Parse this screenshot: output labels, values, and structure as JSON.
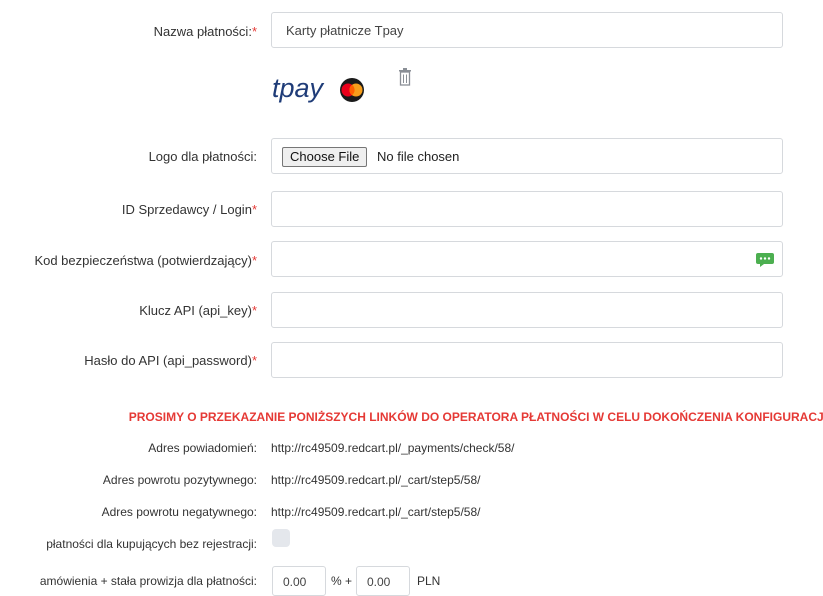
{
  "form": {
    "payment_name": {
      "label": "Nazwa płatności:",
      "required_mark": "*",
      "value": "Karty płatnicze Tpay"
    },
    "logo_image": {
      "brand_text": "tpay",
      "icon": "mastercard-icon"
    },
    "delete_icon": "trash-icon",
    "logo_upload": {
      "label": "Logo dla płatności:",
      "button": "Choose File",
      "status": "No file chosen"
    },
    "merchant_id": {
      "label": "ID Sprzedawcy / Login",
      "required_mark": "*",
      "value": ""
    },
    "security_code": {
      "label": "Kod bezpieczeństwa (potwierdzający)",
      "required_mark": "*",
      "value": "",
      "icon": "chat-icon"
    },
    "api_key": {
      "label": "Klucz API (api_key)",
      "required_mark": "*",
      "value": ""
    },
    "api_password": {
      "label": "Hasło do API (api_password)",
      "required_mark": "*",
      "value": ""
    }
  },
  "notice": "PROSIMY O PRZEKAZANIE PONIŻSZYCH LINKÓW DO OPERATORA PŁATNOŚCI W CELU DOKOŃCZENIA KONFIGURACJI",
  "links": [
    {
      "label": "Adres powiadomień:",
      "value": "http://rc49509.redcart.pl/_payments/check/58/"
    },
    {
      "label": "Adres powrotu pozytywnego:",
      "value": "http://rc49509.redcart.pl/_cart/step5/58/"
    },
    {
      "label": "Adres powrotu negatywnego:",
      "value": "http://rc49509.redcart.pl/_cart/step5/58/"
    }
  ],
  "guest_payment": {
    "label": "płatności dla kupujących bez rejestracji:",
    "checked": false
  },
  "commission": {
    "label": "amówienia + stała prowizja dla płatności:",
    "percent_value": "0.00",
    "percent_sep": "% +",
    "fixed_value": "0.00",
    "currency": "PLN"
  },
  "colors": {
    "accent_red": "#e53935",
    "tpay_blue": "#1f3c78",
    "chat_green": "#4caf50"
  }
}
